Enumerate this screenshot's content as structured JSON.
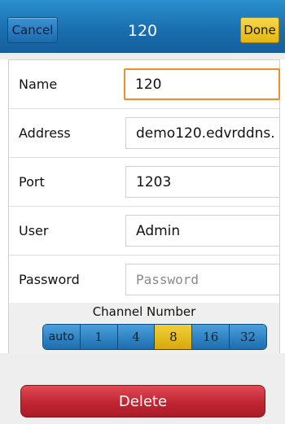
{
  "nav": {
    "cancel_label": "Cancel",
    "title": "120",
    "done_label": "Done"
  },
  "form": {
    "name_label": "Name",
    "name_value": "120",
    "address_label": "Address",
    "address_value": "demo120.edvrddns.",
    "port_label": "Port",
    "port_value": "1203",
    "user_label": "User",
    "user_value": "Admin",
    "password_label": "Password",
    "password_placeholder": "Password"
  },
  "channel": {
    "label": "Channel Number",
    "options": [
      "auto",
      "1",
      "4",
      "8",
      "16",
      "32"
    ],
    "selected": "8"
  },
  "delete_label": "Delete",
  "colors": {
    "nav_bar": "#1a6faf",
    "done_button": "#e3b713",
    "focus_border": "#f08c2a",
    "delete_button": "#c02532"
  }
}
